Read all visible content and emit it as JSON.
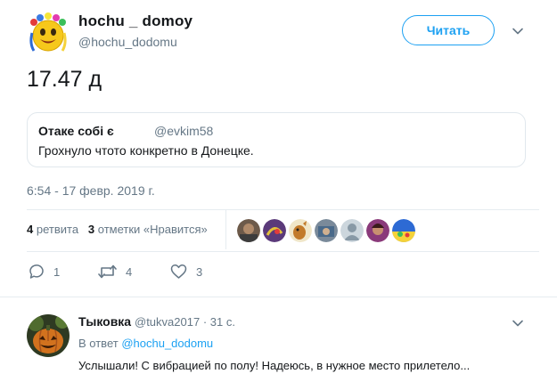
{
  "tweet": {
    "author_name": "hochu _ domoy",
    "author_handle": "@hochu_dodomu",
    "follow_label": "Читать",
    "text": "17.47 д",
    "timestamp": "6:54 - 17 февр. 2019 г."
  },
  "quote": {
    "author_name": "Отаке собі є",
    "author_handle": "@evkim58",
    "text": "Грохнуло чтото конкретно в Донецке."
  },
  "stats": {
    "retweets_count": "4",
    "retweets_label": "ретвита",
    "likes_count": "3",
    "likes_label": "отметки «Нравится»"
  },
  "actions": {
    "reply_count": "1",
    "retweet_count": "4",
    "like_count": "3"
  },
  "reply": {
    "author_name": "Тыковка",
    "author_handle": "@tukva2017",
    "time": "31 с.",
    "in_reply_prefix": "В ответ",
    "in_reply_to": "@hochu_dodomu",
    "text": "Услышали! С вибрацией по полу! Надеюсь, в нужное место прилетело..."
  },
  "colors": {
    "accent": "#1da1f2",
    "muted": "#657786",
    "text": "#14171a",
    "border": "#e6ecf0"
  },
  "icons": {
    "main_avatar": "emoji-smiley-flower-wreath-icon",
    "reply_avatar": "pumpkin-avatar-icon",
    "menu": "chevron-down-icon",
    "reply": "reply-bubble-icon",
    "retweet": "retweet-icon",
    "like": "heart-icon"
  }
}
